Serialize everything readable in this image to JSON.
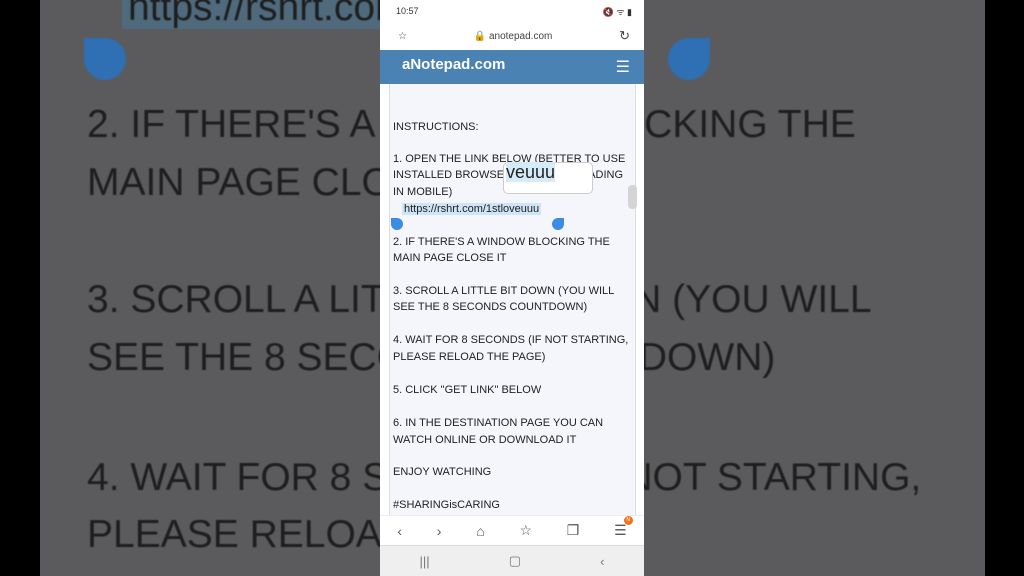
{
  "status": {
    "time": "10:57",
    "icons": [
      "video-icon",
      "youtube-icon",
      "mute-icon",
      "wifi-icon",
      "signal-icon",
      "battery-icon"
    ]
  },
  "browser": {
    "url": "anotepad.com"
  },
  "site": {
    "title": "aNotepad.com"
  },
  "note": {
    "l0": "INSTRUCTIONS:",
    "l1": "1. OPEN THE LINK BELOW (BETTER TO USE",
    "l2": "INSTALLED BROWSER FOR EASY LOADING",
    "l3": "IN MOBILE)",
    "link": "https://rshrt.com/1stloveuuu",
    "l4": "2. IF THERE'S A WINDOW BLOCKING THE",
    "l5": "MAIN PAGE CLOSE IT",
    "l6": "3. SCROLL A LITTLE BIT DOWN (YOU WILL",
    "l7": "SEE THE 8 SECONDS COUNTDOWN)",
    "l8": "4. WAIT FOR 8 SECONDS (IF NOT STARTING,",
    "l9": "PLEASE RELOAD THE PAGE)",
    "l10": "5. CLICK \"GET LINK\" BELOW",
    "l11": "6. IN THE DESTINATION PAGE YOU CAN",
    "l12": "WATCH ONLINE OR DOWNLOAD IT",
    "l13": "ENJOY WATCHING",
    "l14": "#SHARINGisCARING"
  },
  "magnifier": {
    "text": "veuuu"
  },
  "bottom_nav": {
    "badge": "N"
  },
  "colors": {
    "header": "#4b82b4",
    "selection": "#3b8ce4",
    "badge": "#f0731e"
  }
}
